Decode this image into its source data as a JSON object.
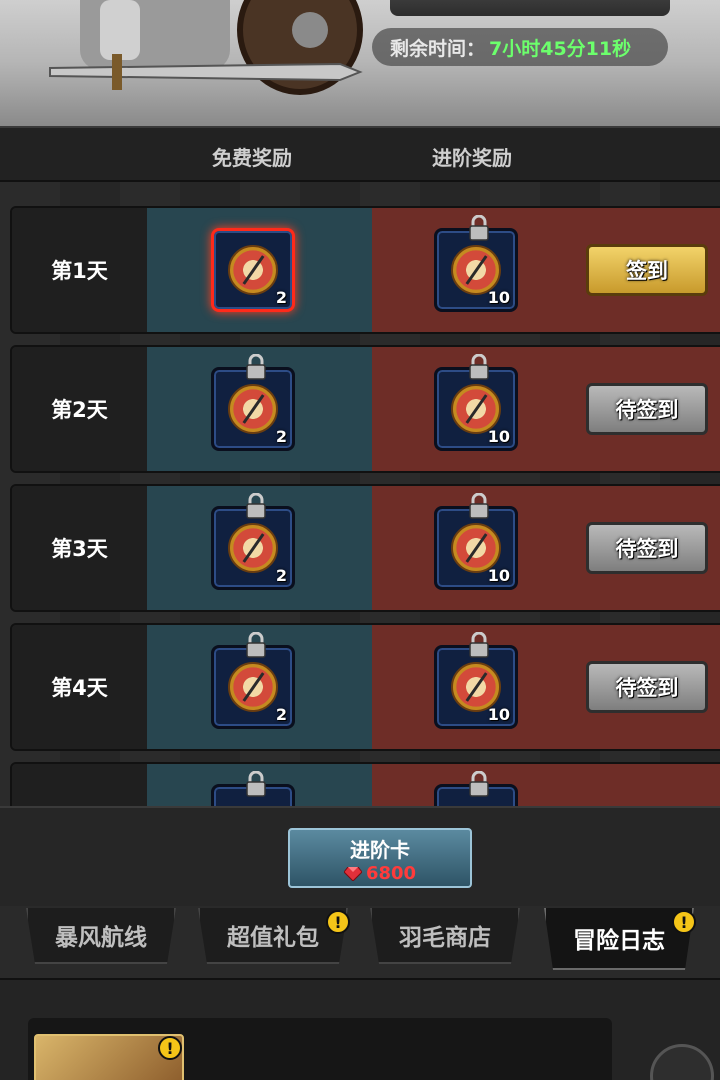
{
  "header": {
    "timer_label": "剩余时间：",
    "timer_value": "7小时45分11秒"
  },
  "columns": {
    "free": "免费奖励",
    "advanced": "进阶奖励"
  },
  "rows": [
    {
      "day": "第1天",
      "free_qty": "2",
      "adv_qty": "10",
      "button": "签到",
      "state": "claimable"
    },
    {
      "day": "第2天",
      "free_qty": "2",
      "adv_qty": "10",
      "button": "待签到",
      "state": "pending"
    },
    {
      "day": "第3天",
      "free_qty": "2",
      "adv_qty": "10",
      "button": "待签到",
      "state": "pending"
    },
    {
      "day": "第4天",
      "free_qty": "2",
      "adv_qty": "10",
      "button": "待签到",
      "state": "pending"
    }
  ],
  "advanced_card": {
    "title": "进阶卡",
    "price": "6800"
  },
  "tabs": [
    {
      "label": "暴风航线",
      "badge": false,
      "active": false
    },
    {
      "label": "超值礼包",
      "badge": true,
      "active": false
    },
    {
      "label": "羽毛商店",
      "badge": false,
      "active": false
    },
    {
      "label": "冒险日志",
      "badge": true,
      "active": true
    }
  ],
  "colors": {
    "free_column": "#284650",
    "advanced_column": "#6e2d27",
    "timer_value": "#6cff6c",
    "price": "#ff3b3b",
    "badge": "#f5c518"
  },
  "icons": {
    "reward": "compass-icon",
    "lock": "lock-icon",
    "currency": "ruby-gem-icon",
    "notice": "exclamation-badge-icon"
  }
}
